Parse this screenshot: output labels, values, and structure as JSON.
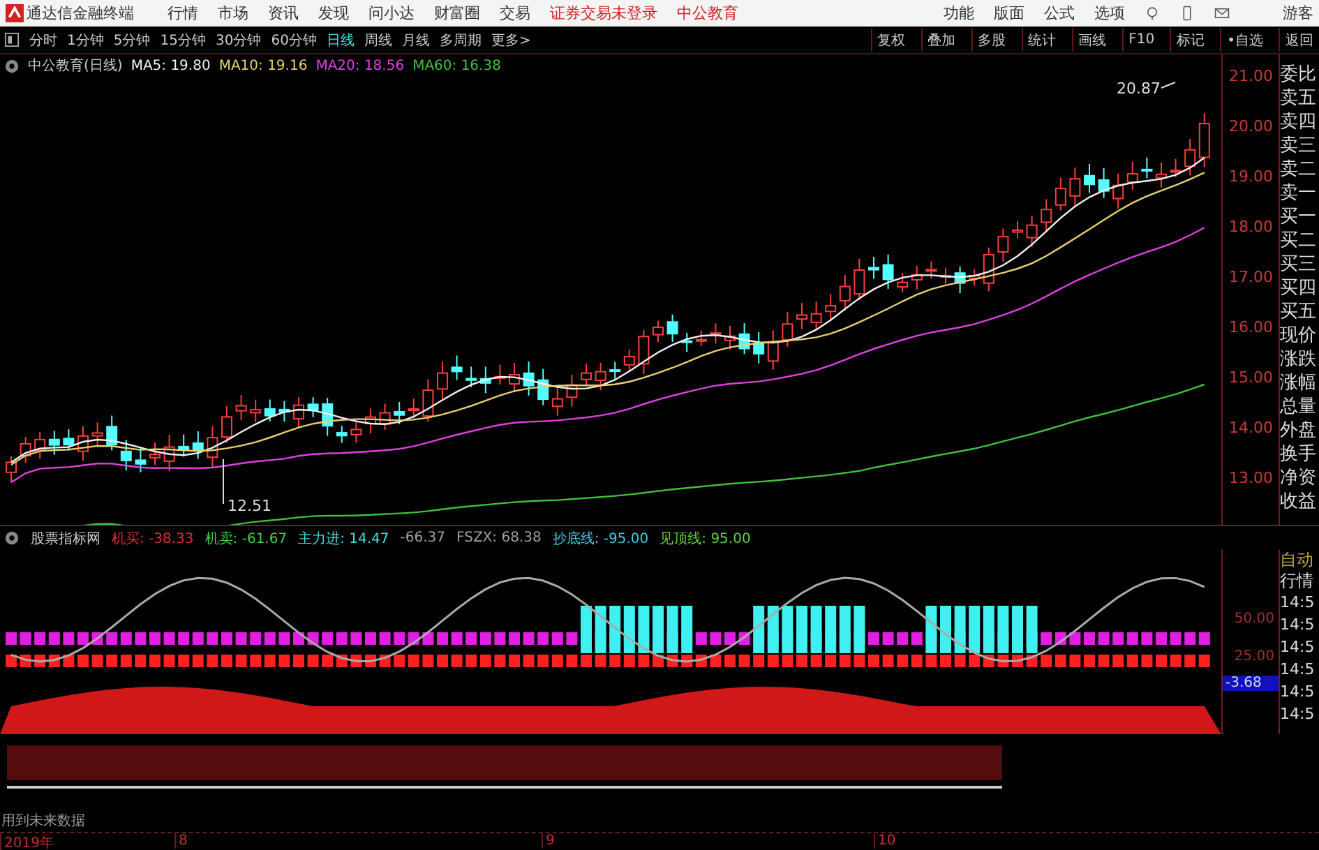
{
  "app": {
    "title": "通达信金融终端",
    "menu": [
      "行情",
      "市场",
      "资讯",
      "发现",
      "问小达",
      "财富圈",
      "交易"
    ],
    "login_status": "证券交易未登录",
    "stock_name": "中公教育",
    "tools": [
      "功能",
      "版面",
      "公式",
      "选项"
    ],
    "user": "游客"
  },
  "periods": [
    {
      "label": "分时",
      "selected": false
    },
    {
      "label": "1分钟",
      "selected": false
    },
    {
      "label": "5分钟",
      "selected": false
    },
    {
      "label": "15分钟",
      "selected": false
    },
    {
      "label": "30分钟",
      "selected": false
    },
    {
      "label": "60分钟",
      "selected": false
    },
    {
      "label": "日线",
      "selected": true
    },
    {
      "label": "周线",
      "selected": false
    },
    {
      "label": "月线",
      "selected": false
    },
    {
      "label": "多周期",
      "selected": false
    },
    {
      "label": "更多>",
      "selected": false
    }
  ],
  "actions": [
    "复权",
    "叠加",
    "多股",
    "统计",
    "画线",
    "F10",
    "标记",
    "•自选",
    "返回"
  ],
  "chart": {
    "title": "中公教育(日线)",
    "ma": [
      {
        "label": "MA5: 19.80",
        "color": "#f0f0f0"
      },
      {
        "label": "MA10: 19.16",
        "color": "#e8d070"
      },
      {
        "label": "MA20: 18.56",
        "color": "#e040e0"
      },
      {
        "label": "MA60: 16.38",
        "color": "#40c040"
      }
    ],
    "price_ticks": [
      "21.00",
      "20.00",
      "19.00",
      "18.00",
      "17.00",
      "16.00",
      "15.00",
      "14.00",
      "13.00"
    ],
    "high_label": "20.87",
    "low_label": "12.51"
  },
  "indicator": {
    "name": "股票指标网",
    "values": [
      {
        "label": "机买: -38.33",
        "color": "#e03030"
      },
      {
        "label": "机卖: -61.67",
        "color": "#40d040"
      },
      {
        "label": "主力进: 14.47",
        "color": "#40e0e0"
      },
      {
        "label": "-66.37",
        "color": "#a0a0a0"
      },
      {
        "label": "FSZX: 68.38",
        "color": "#a0a0a0"
      },
      {
        "label": "抄底线: -95.00",
        "color": "#40c8e8"
      },
      {
        "label": "见顶线: 95.00",
        "color": "#60d040"
      }
    ],
    "ticks": [
      "50.00",
      "25.00"
    ],
    "current": "-3.68"
  },
  "future_note": "用到未来数据",
  "time_axis": [
    "2019年",
    "8",
    "9",
    "10"
  ],
  "quote_panel": [
    "委比",
    "卖五",
    "卖四",
    "卖三",
    "卖二",
    "卖一",
    "买一",
    "买二",
    "买三",
    "买四",
    "买五",
    "现价",
    "涨跌",
    "涨幅",
    "总量",
    "外盘",
    "换手",
    "净资",
    "收益"
  ],
  "tick_panel": {
    "tabs": [
      "自动",
      "行情"
    ],
    "times": [
      "14:5",
      "14:5",
      "14:5",
      "14:5",
      "14:5",
      "14:5"
    ]
  }
}
